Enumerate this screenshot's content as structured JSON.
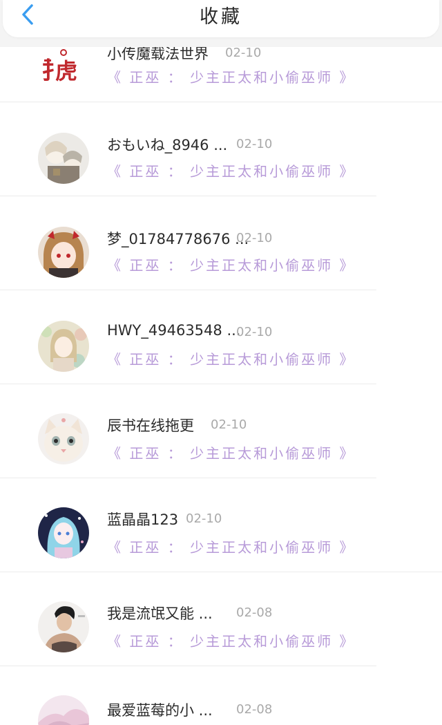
{
  "header": {
    "title": "收藏",
    "back_icon": "chevron-left-icon",
    "accent_color": "#3a9df0"
  },
  "colors": {
    "book_link": "#b79ad8",
    "date": "#a9a9a9",
    "username": "#2b2b2b"
  },
  "items": [
    {
      "username": "小传魔载法世界",
      "date": "02-10",
      "book": "《 正巫 ： 少主正太和小偷巫师 》",
      "avatar": "logo-avatar"
    },
    {
      "username": "おもいね_8946 ...",
      "date": "02-10",
      "book": "《 正巫 ： 少主正太和小偷巫师 》",
      "avatar": "anime-avatar"
    },
    {
      "username": "梦_01784778676 ...",
      "date": "02-10",
      "book": "《 正巫 ： 少主正太和小偷巫师 》",
      "avatar": "anime-avatar"
    },
    {
      "username": "HWY_49463548 ...",
      "date": "02-10",
      "book": "《 正巫 ： 少主正太和小偷巫师 》",
      "avatar": "anime-avatar"
    },
    {
      "username": "辰书在线拖更",
      "date": "02-10",
      "book": "《 正巫 ： 少主正太和小偷巫师 》",
      "avatar": "cat-avatar"
    },
    {
      "username": "蓝晶晶123",
      "date": "02-10",
      "book": "《 正巫 ： 少主正太和小偷巫师 》",
      "avatar": "anime-avatar"
    },
    {
      "username": "我是流氓又能 ...",
      "date": "02-08",
      "book": "《 正巫 ： 少主正太和小偷巫师 》",
      "avatar": "person-avatar"
    },
    {
      "username": "最爱蓝莓的小 ...",
      "date": "02-08",
      "book": "",
      "avatar": "anime-avatar"
    }
  ]
}
